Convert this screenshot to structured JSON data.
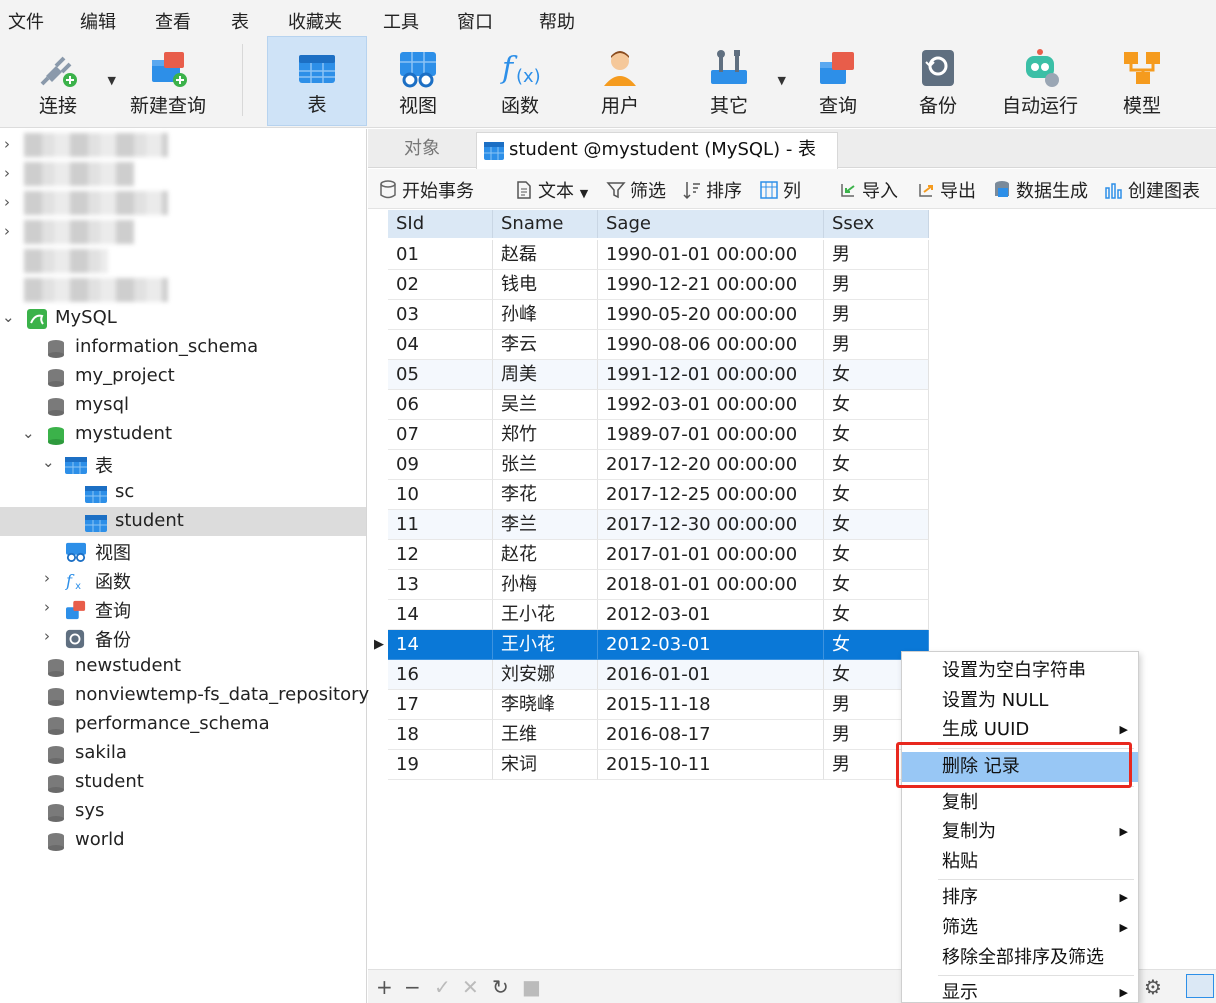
{
  "menu": [
    "文件",
    "编辑",
    "查看",
    "表",
    "收藏夹",
    "工具",
    "窗口",
    "帮助"
  ],
  "toolbar": {
    "items": [
      {
        "label": "连接",
        "icon": "plug-connect-icon"
      },
      {
        "label": "新建查询",
        "icon": "new-query-icon"
      },
      {
        "label": "表",
        "icon": "table-icon",
        "active": true
      },
      {
        "label": "视图",
        "icon": "view-icon"
      },
      {
        "label": "函数",
        "icon": "function-icon"
      },
      {
        "label": "用户",
        "icon": "user-icon"
      },
      {
        "label": "其它",
        "icon": "tools-icon"
      },
      {
        "label": "查询",
        "icon": "query-icon"
      },
      {
        "label": "备份",
        "icon": "backup-icon"
      },
      {
        "label": "自动运行",
        "icon": "robot-icon"
      },
      {
        "label": "模型",
        "icon": "model-icon"
      }
    ]
  },
  "tree": {
    "connection": "MySQL",
    "databases": [
      "information_schema",
      "my_project",
      "mysql",
      "mystudent",
      "newstudent",
      "nonviewtemp-fs_data_repository",
      "performance_schema",
      "sakila",
      "student",
      "sys",
      "world"
    ],
    "mystudent_children": {
      "tables_label": "表",
      "tables": [
        "sc",
        "student"
      ],
      "views_label": "视图",
      "functions_label": "函数",
      "queries_label": "查询",
      "backups_label": "备份"
    }
  },
  "tabs": {
    "objects": "对象",
    "active": "student @mystudent (MySQL) - 表"
  },
  "subtoolbar": {
    "begin_txn": "开始事务",
    "text": "文本",
    "filter": "筛选",
    "sort": "排序",
    "columns": "列",
    "import": "导入",
    "export": "导出",
    "data_gen": "数据生成",
    "create_chart": "创建图表"
  },
  "table": {
    "columns": [
      "SId",
      "Sname",
      "Sage",
      "Ssex"
    ],
    "rows": [
      [
        "01",
        "赵磊",
        "1990-01-01 00:00:00",
        "男"
      ],
      [
        "02",
        "钱电",
        "1990-12-21 00:00:00",
        "男"
      ],
      [
        "03",
        "孙峰",
        "1990-05-20 00:00:00",
        "男"
      ],
      [
        "04",
        "李云",
        "1990-08-06 00:00:00",
        "男"
      ],
      [
        "05",
        "周美",
        "1991-12-01 00:00:00",
        "女"
      ],
      [
        "06",
        "吴兰",
        "1992-03-01 00:00:00",
        "女"
      ],
      [
        "07",
        "郑竹",
        "1989-07-01 00:00:00",
        "女"
      ],
      [
        "09",
        "张兰",
        "2017-12-20 00:00:00",
        "女"
      ],
      [
        "10",
        "李花",
        "2017-12-25 00:00:00",
        "女"
      ],
      [
        "11",
        "李兰",
        "2017-12-30 00:00:00",
        "女"
      ],
      [
        "12",
        "赵花",
        "2017-01-01 00:00:00",
        "女"
      ],
      [
        "13",
        "孙梅",
        "2018-01-01 00:00:00",
        "女"
      ],
      [
        "14",
        "王小花",
        "2012-03-01",
        "女"
      ],
      [
        "14",
        "王小花",
        "2012-03-01",
        "女"
      ],
      [
        "16",
        "刘安娜",
        "2016-01-01",
        "女"
      ],
      [
        "17",
        "李晓峰",
        "2015-11-18",
        "男"
      ],
      [
        "18",
        "王维",
        "2016-08-17",
        "男"
      ],
      [
        "19",
        "宋词",
        "2015-10-11",
        "男"
      ]
    ],
    "selected_row": 13
  },
  "context_menu": {
    "items": [
      {
        "label": "设置为空白字符串",
        "submenu": false
      },
      {
        "label": "设置为 NULL",
        "submenu": false
      },
      {
        "label": "生成 UUID",
        "submenu": true
      },
      {
        "label": "删除 记录",
        "submenu": false,
        "highlight": true
      },
      {
        "label": "复制",
        "submenu": false
      },
      {
        "label": "复制为",
        "submenu": true
      },
      {
        "label": "粘贴",
        "submenu": false
      },
      {
        "label": "排序",
        "submenu": true
      },
      {
        "label": "筛选",
        "submenu": true
      },
      {
        "label": "移除全部排序及筛选",
        "submenu": false
      },
      {
        "label": "显示",
        "submenu": true
      }
    ]
  },
  "colors": {
    "selection": "#0a78d7",
    "menu_highlight": "#98c7f5",
    "annotation_box": "#e8281e"
  }
}
